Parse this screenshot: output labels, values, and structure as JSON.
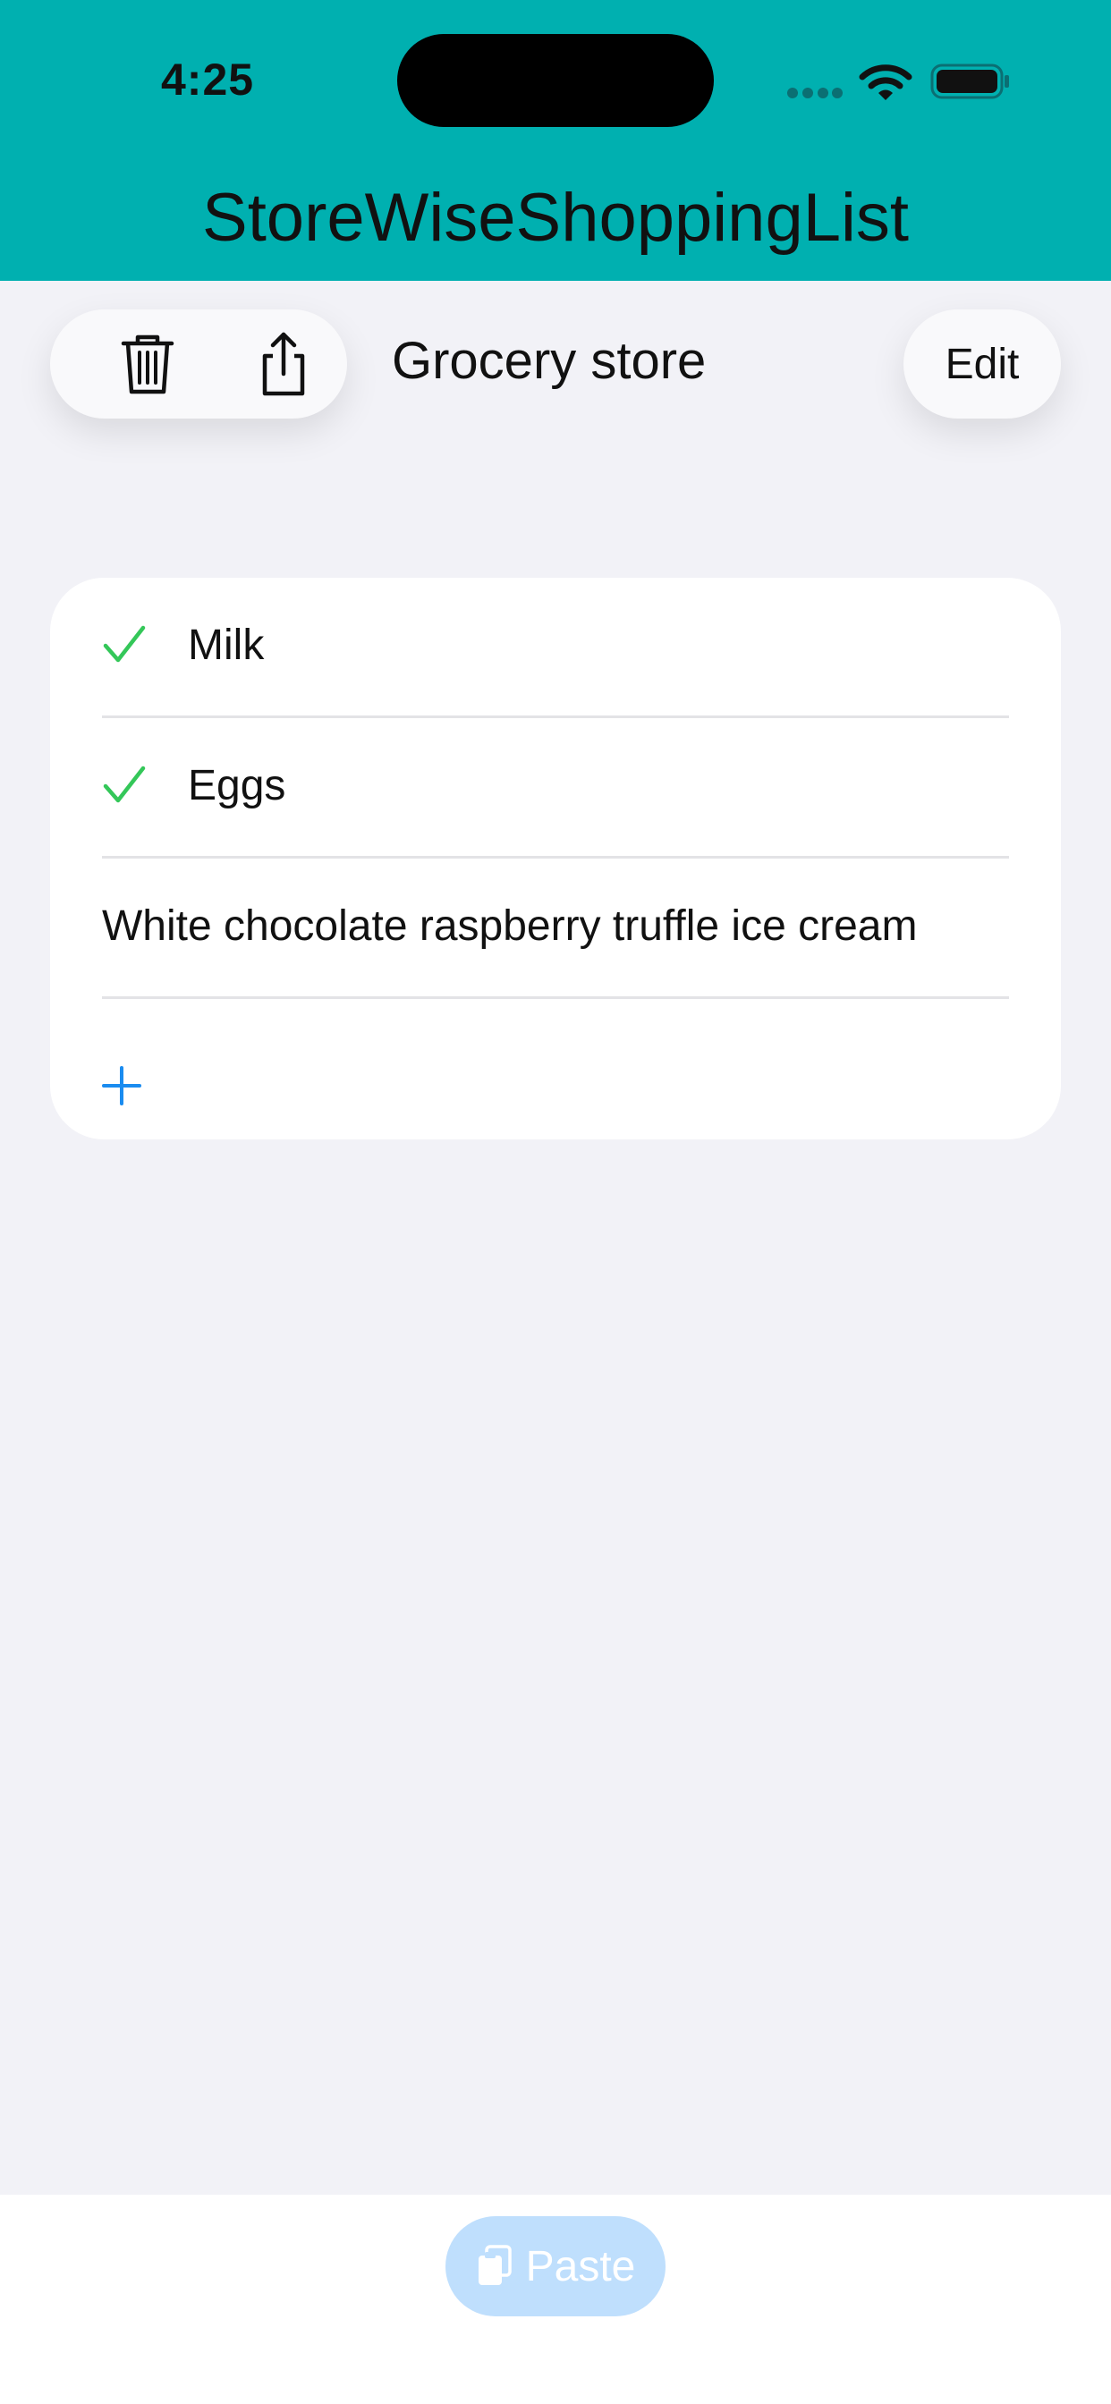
{
  "status_bar": {
    "time": "4:25"
  },
  "header": {
    "title": "StoreWiseShoppingList"
  },
  "toolbar": {
    "list_name": "Grocery store",
    "edit_label": "Edit"
  },
  "items": [
    {
      "label": "Milk",
      "checked": true
    },
    {
      "label": "Eggs",
      "checked": true
    },
    {
      "label": "White chocolate raspberry truffle ice cream",
      "checked": false
    }
  ],
  "bottom": {
    "paste_label": "Paste"
  },
  "colors": {
    "header_bg": "#00b0b0",
    "page_bg": "#f2f2f7",
    "check": "#34c759",
    "accent": "#1a8cf0",
    "paste_bg": "#bfdffd"
  },
  "icons": [
    "trash-icon",
    "share-icon",
    "checkmark-icon",
    "plus-icon",
    "clipboard-icon",
    "wifi-icon",
    "battery-icon"
  ]
}
